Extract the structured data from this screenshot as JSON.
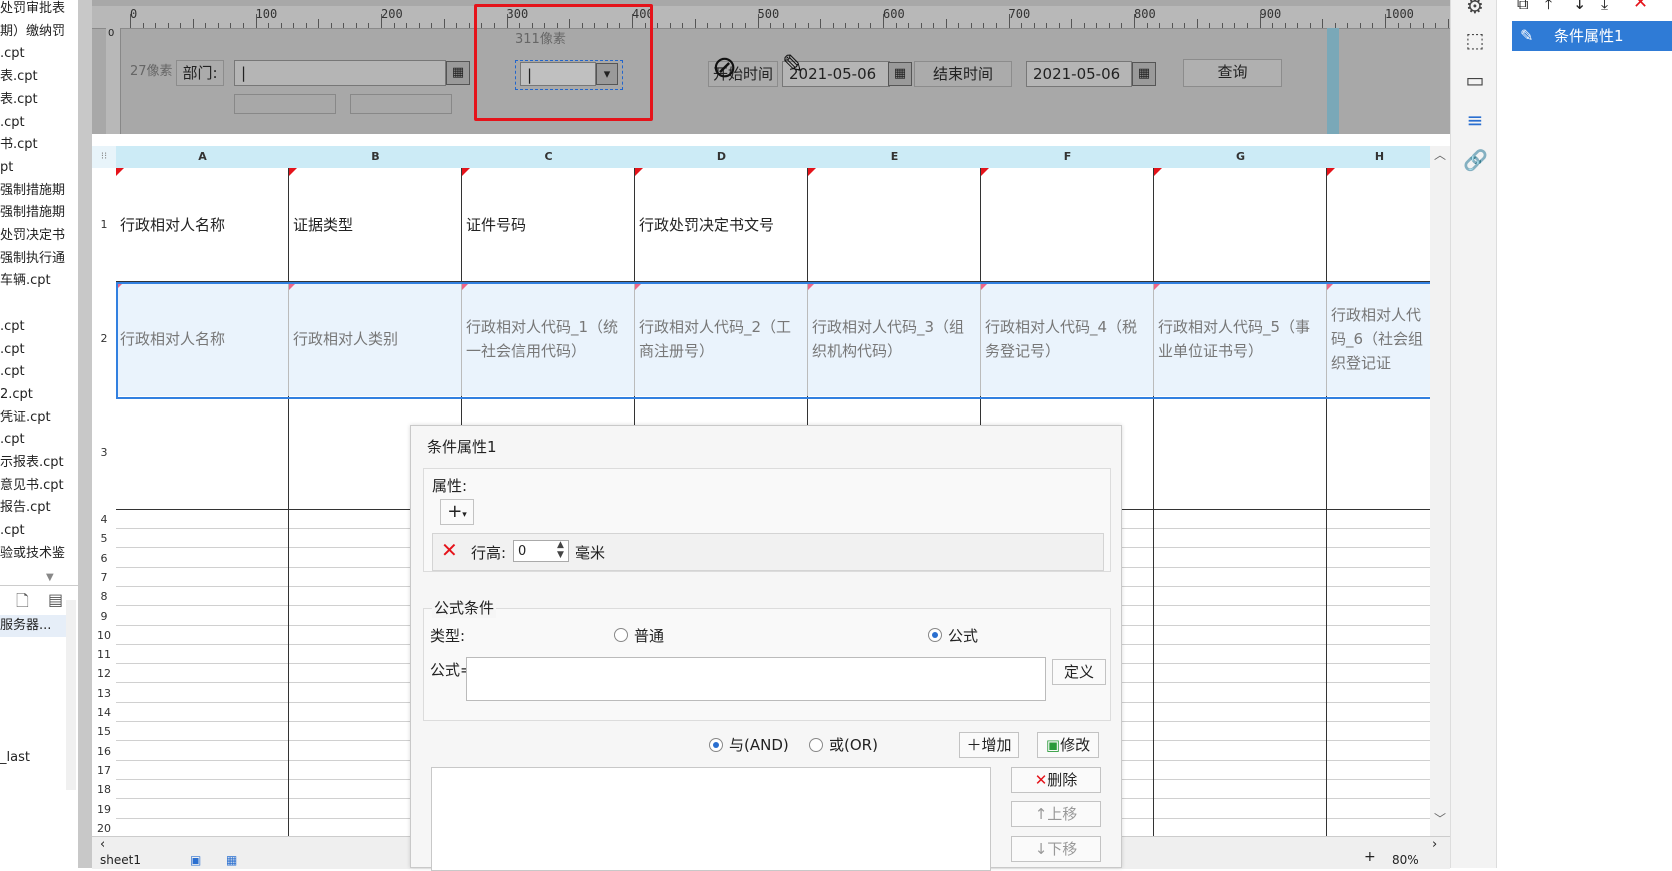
{
  "file_tree": {
    "items": [
      "处罚审批表",
      "期）缴纳罚",
      ".cpt",
      "表.cpt",
      "表.cpt",
      ".cpt",
      "书.cpt",
      "pt",
      "强制措施期",
      "强制措施期",
      "处罚决定书",
      "强制执行通",
      "车辆.cpt",
      "",
      ".cpt",
      ".cpt",
      ".cpt",
      "2.cpt",
      "凭证.cpt",
      ".cpt",
      "示报表.cpt",
      "意见书.cpt",
      "报告.cpt",
      ".cpt",
      "验或技术鉴"
    ],
    "server_label": "服务器..."
  },
  "ruler": {
    "labels": [
      "0",
      "100",
      "200",
      "300",
      "400",
      "500",
      "600",
      "700",
      "800",
      "900",
      "1000"
    ]
  },
  "params": {
    "px27": "27像素",
    "px311": "311像素",
    "dept_label": "部门:",
    "start_label": "开始时间",
    "start_date": "2021-05-06",
    "end_label": "结束时间",
    "end_date": "2021-05-06",
    "query_btn": "查询"
  },
  "sheet": {
    "columns": [
      "A",
      "B",
      "C",
      "D",
      "E",
      "F",
      "G",
      "H"
    ],
    "row_numbers": [
      "1",
      "2",
      "3",
      "4",
      "5",
      "6",
      "7",
      "8",
      "9",
      "10",
      "11",
      "12",
      "13",
      "14",
      "15",
      "16",
      "17",
      "18",
      "19",
      "20"
    ],
    "row1": [
      "行政相对人名称",
      "证据类型",
      "证件号码",
      "行政处罚决定书文号",
      "",
      "",
      "",
      ""
    ],
    "row2": [
      "行政相对人名称",
      "行政相对人类别",
      "行政相对人代码_1（统一社会信用代码）",
      "行政相对人代码_2（工商注册号）",
      "行政相对人代码_3（组织机构代码）",
      "行政相对人代码_4（税务登记号）",
      "行政相对人代码_5（事业单位证书号）",
      "行政相对人代码_6（社会组织登记证"
    ],
    "tab": "sheet1"
  },
  "dialog": {
    "title": "条件属性1",
    "attr_label": "属性:",
    "row_height_label": "行高:",
    "row_height_value": "0",
    "unit": "毫米",
    "formula_cond": "公式条件",
    "type_label": "类型:",
    "opt_normal": "普通",
    "opt_formula": "公式",
    "formula_label": "公式=",
    "define_btn": "定义",
    "and_label": "与(AND)",
    "or_label": "或(OR)",
    "add_btn": "增加",
    "modify_btn": "修改",
    "delete_btn": "删除",
    "up_btn": "上移",
    "down_btn": "下移"
  },
  "right_panel": {
    "cond_item": "条件属性1"
  },
  "zoom": "80%"
}
